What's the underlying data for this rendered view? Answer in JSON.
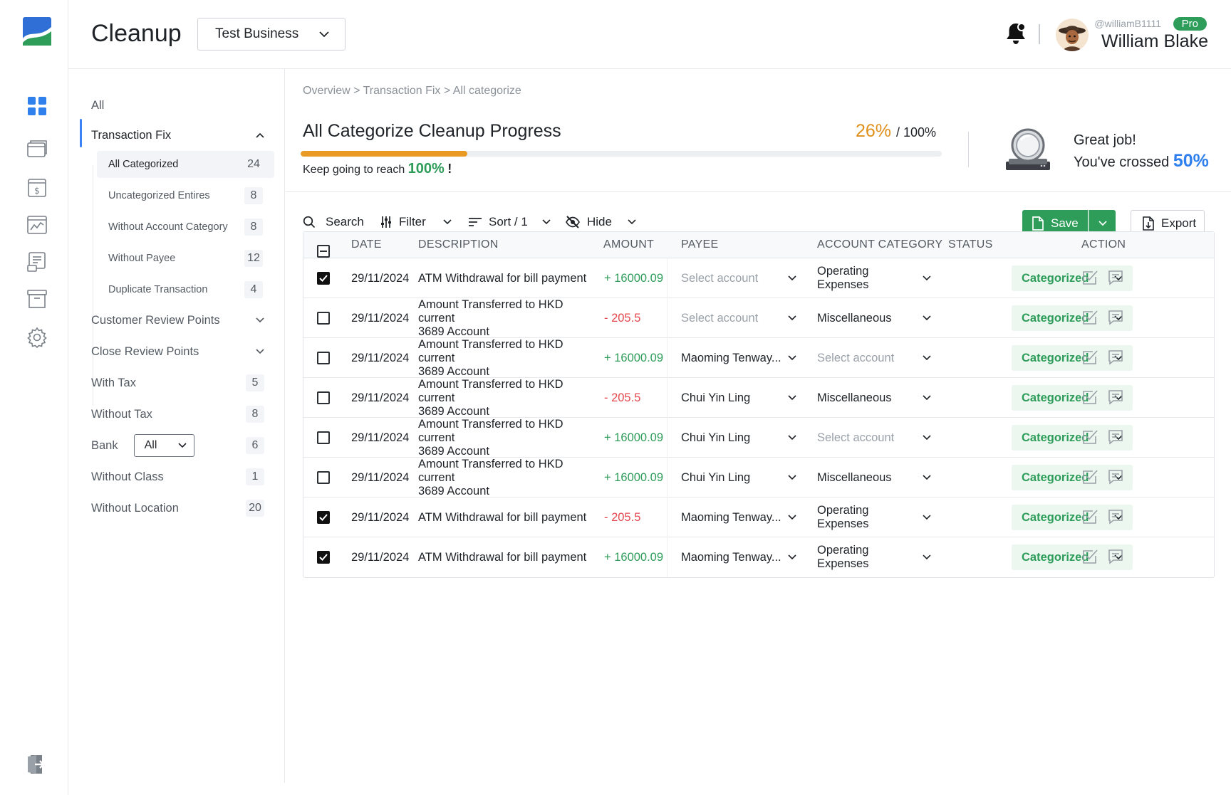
{
  "app": {
    "title": "Cleanup",
    "business": "Test Business"
  },
  "user": {
    "handle": "@williamB1111",
    "plan": "Pro",
    "name": "William Blake"
  },
  "leftnav": {
    "all": "All",
    "transaction_fix": "Transaction Fix",
    "sub_items": [
      {
        "label": "All Categorized",
        "count": "24"
      },
      {
        "label": "Uncategorized Entires",
        "count": "8"
      },
      {
        "label": "Without Account Category",
        "count": "8"
      },
      {
        "label": "Without Payee",
        "count": "12"
      },
      {
        "label": "Duplicate Transaction",
        "count": "4"
      }
    ],
    "customer_review": "Customer Review Points",
    "close_review": "Close Review Points",
    "with_tax": {
      "label": "With Tax",
      "count": "5"
    },
    "without_tax": {
      "label": "Without Tax",
      "count": "8"
    },
    "bank": {
      "label": "Bank",
      "selected": "All",
      "count": "6"
    },
    "without_class": {
      "label": "Without Class",
      "count": "1"
    },
    "without_location": {
      "label": "Without Location",
      "count": "20"
    }
  },
  "breadcrumb": "Overview > Transaction Fix > All categorize",
  "progress": {
    "title": "All Categorize Cleanup Progress",
    "percent_label": "26%",
    "total_label": "/ 100%",
    "value": 0.26,
    "hint_prefix": "Keep going to reach",
    "hint_goal": "100%",
    "hint_suffix": "!"
  },
  "congrats": {
    "line1": "Great job!",
    "line2_prefix": "You've crossed",
    "line2_value": "50%"
  },
  "toolbar": {
    "search": "Search",
    "filter": "Filter",
    "sort": "Sort / 1",
    "hide": "Hide",
    "save": "Save",
    "export": "Export"
  },
  "table": {
    "headers": {
      "date": "DATE",
      "description": "DESCRIPTION",
      "amount": "AMOUNT",
      "payee": "PAYEE",
      "account_category": "ACCOUNT CATEGORY",
      "status": "STATUS",
      "action": "ACTION"
    },
    "rows": [
      {
        "checked": true,
        "date": "29/11/2024",
        "desc1": "ATM Withdrawal for bill payment",
        "desc2": "",
        "amount": "+ 16000.09",
        "sign": "pos",
        "payee": "Select account",
        "payee_placeholder": true,
        "category": "Operating Expenses",
        "category_placeholder": false,
        "status": "Categorized"
      },
      {
        "checked": false,
        "date": "29/11/2024",
        "desc1": "Amount Transferred to HKD current",
        "desc2": "3689 Account",
        "amount": "- 205.5",
        "sign": "neg",
        "payee": "Select account",
        "payee_placeholder": true,
        "category": "Miscellaneous",
        "category_placeholder": false,
        "status": "Categorized"
      },
      {
        "checked": false,
        "date": "29/11/2024",
        "desc1": "Amount Transferred to HKD current",
        "desc2": "3689 Account",
        "amount": "+ 16000.09",
        "sign": "pos",
        "payee": "Maoming Tenway...",
        "payee_placeholder": false,
        "category": "Select account",
        "category_placeholder": true,
        "status": "Categorized"
      },
      {
        "checked": false,
        "date": "29/11/2024",
        "desc1": "Amount Transferred to HKD current",
        "desc2": "3689 Account",
        "amount": "- 205.5",
        "sign": "neg",
        "payee": "Chui Yin Ling",
        "payee_placeholder": false,
        "category": "Miscellaneous",
        "category_placeholder": false,
        "status": "Categorized"
      },
      {
        "checked": false,
        "date": "29/11/2024",
        "desc1": "Amount Transferred to HKD current",
        "desc2": "3689 Account",
        "amount": "+ 16000.09",
        "sign": "pos",
        "payee": "Chui Yin Ling",
        "payee_placeholder": false,
        "category": "Select account",
        "category_placeholder": true,
        "status": "Categorized"
      },
      {
        "checked": false,
        "date": "29/11/2024",
        "desc1": "Amount Transferred to HKD current",
        "desc2": "3689 Account",
        "amount": "+ 16000.09",
        "sign": "pos",
        "payee": "Chui Yin Ling",
        "payee_placeholder": false,
        "category": "Miscellaneous",
        "category_placeholder": false,
        "status": "Categorized"
      },
      {
        "checked": true,
        "date": "29/11/2024",
        "desc1": "ATM Withdrawal for bill payment",
        "desc2": "",
        "amount": "- 205.5",
        "sign": "neg",
        "payee": "Maoming Tenway...",
        "payee_placeholder": false,
        "category": "Operating Expenses",
        "category_placeholder": false,
        "status": "Categorized"
      },
      {
        "checked": true,
        "date": "29/11/2024",
        "desc1": "ATM Withdrawal for bill payment",
        "desc2": "",
        "amount": "+ 16000.09",
        "sign": "pos",
        "payee": "Maoming Tenway...",
        "payee_placeholder": false,
        "category": "Operating Expenses",
        "category_placeholder": false,
        "status": "Categorized"
      }
    ]
  },
  "colors": {
    "accent_green": "#2e9d5a",
    "progress_orange": "#e89a25",
    "accent_blue": "#2f80ed",
    "negative_red": "#e5484d"
  },
  "icons": [
    "dashboard-icon",
    "wallet-icon",
    "invoice-icon",
    "chart-icon",
    "report-icon",
    "archive-icon",
    "settings-icon",
    "logout-icon",
    "bell-icon",
    "search-icon",
    "filter-icon",
    "sort-icon",
    "hide-icon",
    "save-file-icon",
    "export-icon",
    "approve-icon",
    "comment-icon",
    "chevron-down-icon"
  ]
}
